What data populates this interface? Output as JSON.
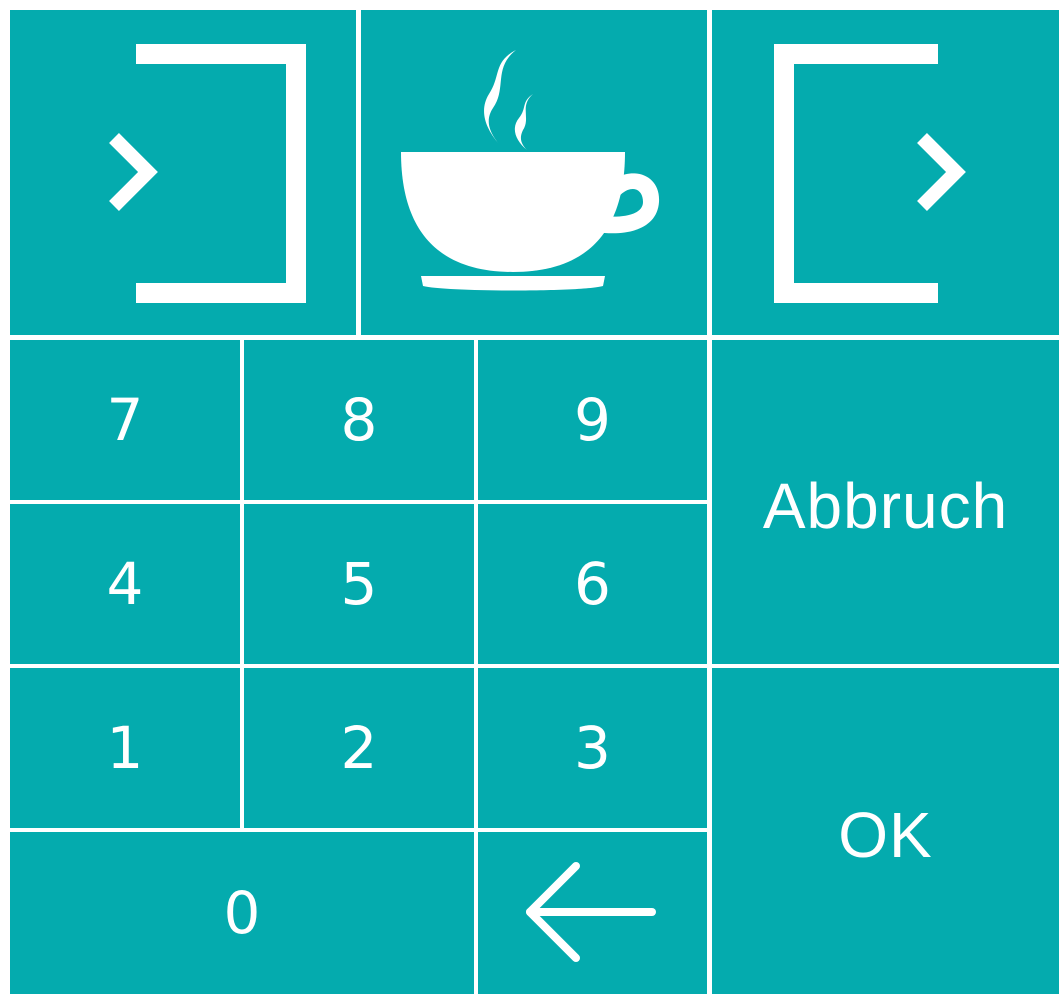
{
  "colors": {
    "key_background": "#04abae",
    "grid_lines": "#ffffff",
    "foreground": "#ffffff"
  },
  "top_row": {
    "login_icon": "login-arrow-into-bracket-icon",
    "coffee_icon": "coffee-cup-icon",
    "logout_icon": "logout-arrow-out-of-bracket-icon"
  },
  "numpad": {
    "k7": "7",
    "k8": "8",
    "k9": "9",
    "k4": "4",
    "k5": "5",
    "k6": "6",
    "k1": "1",
    "k2": "2",
    "k3": "3",
    "k0": "0",
    "backspace_icon": "left-arrow-icon"
  },
  "actions": {
    "cancel_label": "Abbruch",
    "ok_label": "OK"
  }
}
